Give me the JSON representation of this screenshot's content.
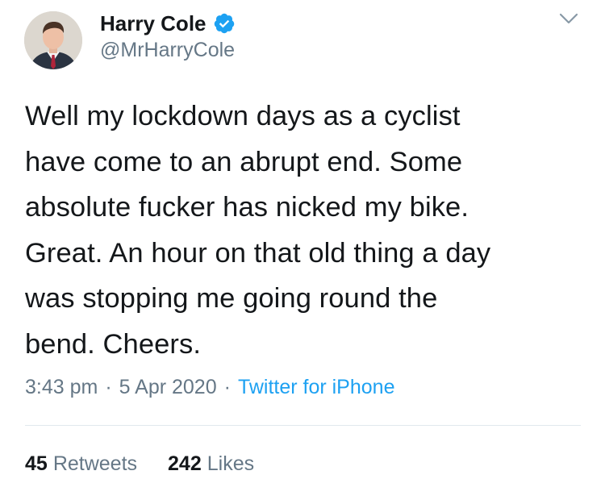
{
  "user": {
    "display_name": "Harry Cole",
    "handle": "@MrHarryCole",
    "verified_icon": "verified-badge-icon",
    "verified_color": "#1da1f2"
  },
  "tweet": {
    "text": "Well my lockdown days as a cyclist\nhave come to an abrupt end. Some\nabsolute fucker has nicked my bike.\nGreat. An hour on that old thing a day\nwas stopping me going round the\nbend.  Cheers.",
    "time": "3:43 pm",
    "separator": "·",
    "date": "5 Apr 2020",
    "source": "Twitter for iPhone"
  },
  "stats": {
    "retweets_count": "45",
    "retweets_label": "Retweets",
    "likes_count": "242",
    "likes_label": "Likes"
  },
  "menu": {
    "icon": "chevron-down-icon"
  },
  "colors": {
    "text": "#14171a",
    "secondary": "#657786",
    "link": "#1da1f2",
    "divider": "#e1e8ed"
  }
}
